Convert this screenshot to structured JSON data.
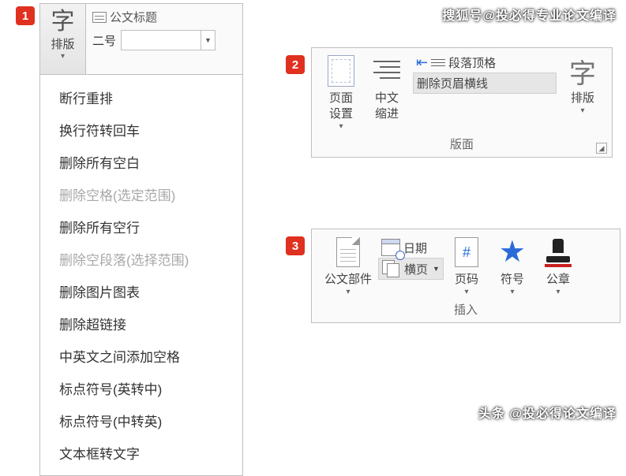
{
  "watermarks": {
    "top": "搜狐号@投必得专业论文编译",
    "bottom": "头条 @投必得论文编译"
  },
  "markers": {
    "m1": "1",
    "m2": "2",
    "m3": "3"
  },
  "panel1": {
    "button_big": "字",
    "button_label": "排版",
    "title_label": "公文标题",
    "size_label": "二号",
    "menu": [
      {
        "label": "断行重排",
        "disabled": false
      },
      {
        "label": "换行符转回车",
        "disabled": false
      },
      {
        "label": "删除所有空白",
        "disabled": false
      },
      {
        "label": "删除空格(选定范围)",
        "disabled": true
      },
      {
        "label": "删除所有空行",
        "disabled": false
      },
      {
        "label": "删除空段落(选择范围)",
        "disabled": true
      },
      {
        "label": "删除图片图表",
        "disabled": false
      },
      {
        "label": "删除超链接",
        "disabled": false
      },
      {
        "label": "中英文之间添加空格",
        "disabled": false
      },
      {
        "label": "标点符号(英转中)",
        "disabled": false
      },
      {
        "label": "标点符号(中转英)",
        "disabled": false
      },
      {
        "label": "文本框转文字",
        "disabled": false
      }
    ]
  },
  "panel2": {
    "page_setup": "页面\n设置",
    "cn_indent": "中文\n缩进",
    "para_top": "段落顶格",
    "del_header_line": "删除页眉横线",
    "typeset_big": "字",
    "typeset_label": "排版",
    "group_label": "版面"
  },
  "panel3": {
    "doc_parts": "公文部件",
    "date": "日期",
    "landscape": "横页",
    "page_num": "页码",
    "symbol": "符号",
    "stamp": "公章",
    "group_label": "插入"
  }
}
